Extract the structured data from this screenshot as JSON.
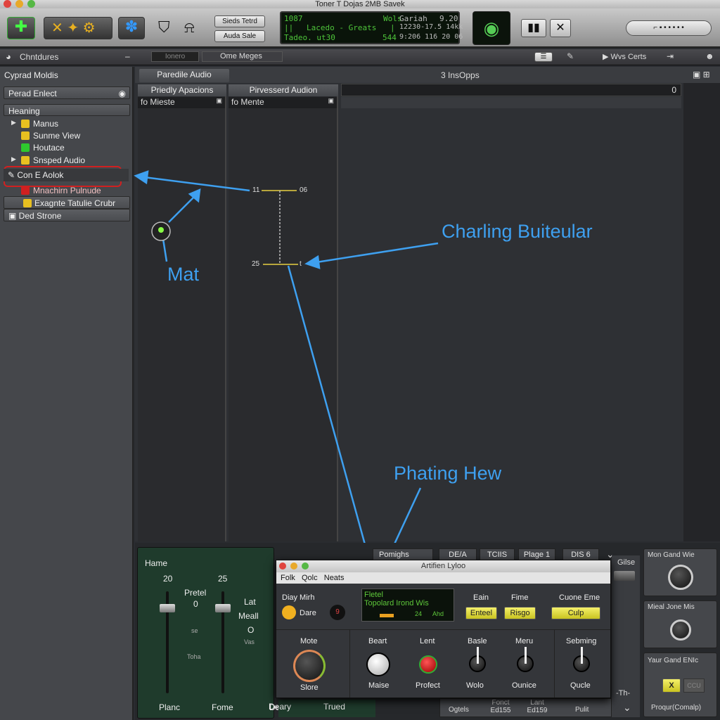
{
  "window": {
    "title": "Toner T Dojas 2MB Savek"
  },
  "toolbar": {
    "btn1": "Sieds Tetrd",
    "btn2": "Auda Sale",
    "lcd": {
      "l1a": "1087",
      "l1b": "Wols",
      "l1c": "Gariah",
      "l1d": "9.20",
      "l2a": "||",
      "l2b": "Lacedo - Greats",
      "l2c": "|",
      "l2d": "12230-17.5 14kk",
      "l3a": "Tadeo. ut30",
      "l3b": "544",
      "l3c": "9:206 116 20 06"
    }
  },
  "bar2": {
    "title": "Chntdures",
    "field1": "Ionero",
    "field2": "Ome Meges",
    "right": "Wvs Certs"
  },
  "sidebar": {
    "header": "Cyprad Moldis",
    "dropdown": "Perad Enlect",
    "section": "Heaning",
    "items": [
      {
        "label": "Manus",
        "color": "#e8c020"
      },
      {
        "label": "Sunme View",
        "color": "#e8c020"
      },
      {
        "label": "Houtace",
        "color": "#2ec82e"
      },
      {
        "label": "Snsped Audio",
        "color": "#e8c020"
      },
      {
        "label": "Con E Aolok",
        "color": ""
      },
      {
        "label": "Mnachirn Pulnude",
        "color": "#d02020"
      },
      {
        "label": "Exagnte Tatulie Crubr",
        "color": "#e8c020"
      },
      {
        "label": "Ded Strone",
        "color": "#ddd"
      }
    ],
    "selected": "Con E Aolok"
  },
  "main": {
    "tab": "Paredile Audio",
    "header": "3 InsOpps",
    "col1": "Priedly Apacions",
    "col2": "Pirvesserd Audion",
    "row1": "fo Mieste",
    "row2": "fo Mente",
    "track_value": "0"
  },
  "markers": {
    "m1": "11",
    "m2": "06",
    "m3": "25",
    "m4": "t"
  },
  "annotations": {
    "a1": "Mat",
    "a2": "Charling Buiteular",
    "a3": "Phating Hew",
    "color": "#3ea0f0"
  },
  "mixer": {
    "title": "Hame",
    "v1": "20",
    "v2": "25",
    "pretel": "Pretel",
    "zero": "0",
    "lat": "Lat",
    "meall": "Meall",
    "o": "O",
    "se": "se",
    "vas": "Vas",
    "toha": "Toha",
    "bottom": [
      "Planc",
      "Fome",
      "Deary",
      "Trued"
    ]
  },
  "tabs2": [
    "Pomighs",
    "DE/A",
    "TCIIS",
    "Plage 1",
    "DIS 6"
  ],
  "tabs2_bottom": [
    "Ogtels",
    "Fonct Ed155",
    "Lant Ed159",
    "Pulit"
  ],
  "strip": {
    "top": "Gilse",
    "bottom": "-Th-"
  },
  "popup": {
    "title": "Artifien Lyloo",
    "menu": [
      "Folk",
      "Qolc",
      "Neats"
    ],
    "daily": "Diay Mirh",
    "dare": "Dare",
    "knob_small": "9",
    "lcd": {
      "l1": "Fletel",
      "l2": "Topolard Irond Wis",
      "l3": "24",
      "l4": "Ahd"
    },
    "eain": "Eain",
    "fime": "Fime",
    "cuone": "Cuone Eme",
    "b1": "Enteel",
    "b2": "Risgo",
    "b3": "Culp",
    "knobs": [
      {
        "top": "Mote",
        "bottom": "Slore"
      },
      {
        "top": "Beart",
        "bottom": "Maise"
      },
      {
        "top": "Lent",
        "bottom": "Profect"
      },
      {
        "top": "Basle",
        "bottom": "Wolo"
      },
      {
        "top": "Meru",
        "bottom": "Ounice"
      },
      {
        "top": "Sebming",
        "bottom": "Qucle"
      }
    ]
  },
  "rpanels": {
    "p1": "Mon Gand Wie",
    "p2": "Mieal Jone Mis",
    "p3": "Yaur Gand ENIc",
    "p3btn": "X",
    "p3btn2": "CCU",
    "p3foot": "Proqur(Comalp)"
  }
}
